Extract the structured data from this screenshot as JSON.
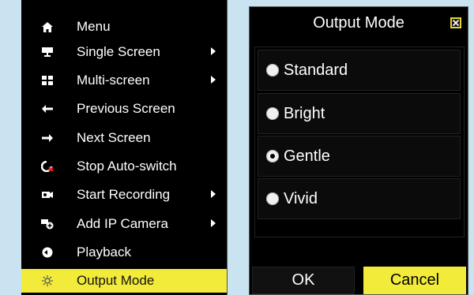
{
  "menu": {
    "items": [
      {
        "label": "Menu",
        "icon": "home-icon",
        "submenu": false
      },
      {
        "label": "Single Screen",
        "icon": "monitor-stand-icon",
        "submenu": true
      },
      {
        "label": "Multi-screen",
        "icon": "grid-icon",
        "submenu": true
      },
      {
        "label": "Previous Screen",
        "icon": "arrow-left-icon",
        "submenu": false
      },
      {
        "label": "Next Screen",
        "icon": "arrow-right-icon",
        "submenu": false
      },
      {
        "label": "Stop Auto-switch",
        "icon": "stop-switch-icon",
        "submenu": false
      },
      {
        "label": "Start Recording",
        "icon": "record-icon",
        "submenu": true
      },
      {
        "label": "Add IP Camera",
        "icon": "camera-add-icon",
        "submenu": true
      },
      {
        "label": "Playback",
        "icon": "playback-icon",
        "submenu": false
      },
      {
        "label": "Output Mode",
        "icon": "sun-icon",
        "submenu": false,
        "active": true
      }
    ]
  },
  "dialog": {
    "title": "Output Mode",
    "options": [
      "Standard",
      "Bright",
      "Gentle",
      "Vivid"
    ],
    "selected": "Gentle",
    "ok": "OK",
    "cancel": "Cancel"
  },
  "colors": {
    "accent": "#f2eb3a",
    "background": "#c9e3f0",
    "panel": "#000000"
  }
}
